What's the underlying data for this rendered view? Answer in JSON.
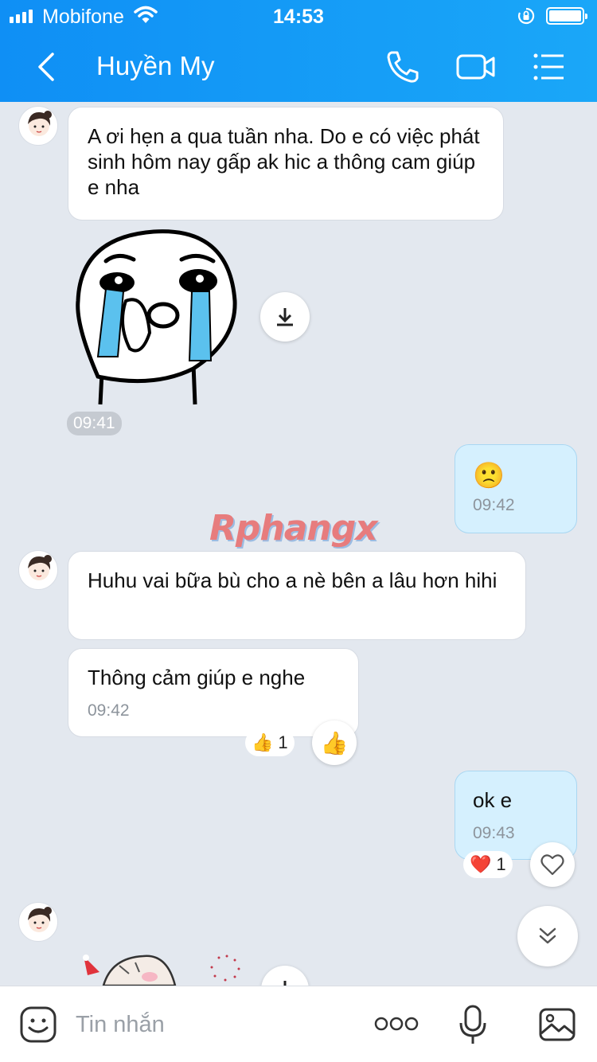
{
  "status_bar": {
    "carrier": "Mobifone",
    "time": "14:53"
  },
  "header": {
    "contact_name": "Huyền My"
  },
  "messages": {
    "m1": {
      "text": "A ơi hẹn a qua tuần nha. Do e có việc phát sinh hôm nay gấp ak hic a thông cam giúp e nha"
    },
    "sticker1": {
      "time": "09:41"
    },
    "m2": {
      "emoji": "🙁",
      "time": "09:42"
    },
    "m3": {
      "text": "Huhu vai bữa bù cho a nè bên a lâu hơn hihi"
    },
    "m4": {
      "text": "Thông cảm giúp e nghe",
      "time": "09:42",
      "reaction_emoji": "👍",
      "reaction_count": "1",
      "react_button_emoji": "👍"
    },
    "m5": {
      "text": "ok e",
      "time": "09:43",
      "reaction_emoji": "❤️",
      "reaction_count": "1"
    }
  },
  "watermark": "Rphangx",
  "input": {
    "placeholder": "Tin nhắn"
  },
  "colors": {
    "header": "#1aa7f8",
    "my_bubble": "#d5f0fe",
    "background": "#e3e8ef"
  },
  "icons": [
    "back-icon",
    "phone-icon",
    "video-icon",
    "menu-icon",
    "download-icon",
    "heart-icon",
    "chevron-down-icon",
    "emoji-icon",
    "more-icon",
    "mic-icon",
    "image-icon"
  ]
}
